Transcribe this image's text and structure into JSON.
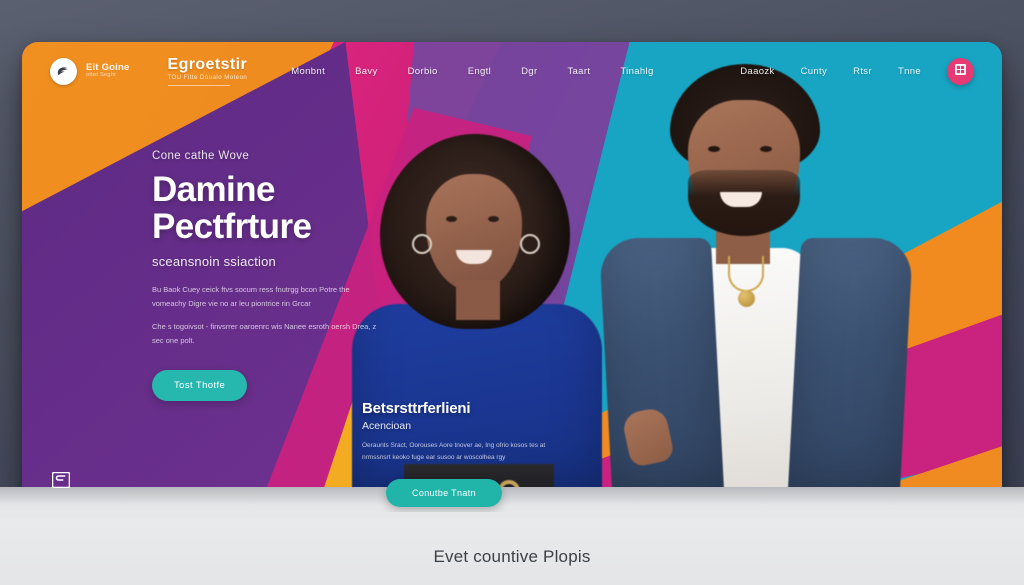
{
  "page": {
    "bottom_caption": "Evet countive Plopis"
  },
  "navbar": {
    "brand_left": {
      "icon": "swoosh-logo-icon",
      "line1": "Eit Goine",
      "line2": "ottet Seght"
    },
    "brand_center": {
      "wordmark": "Egroetstir",
      "subtitle": "TOU   Fitte Doualo Moteon"
    },
    "links": [
      {
        "label": "Monbnt"
      },
      {
        "label": "Bavy"
      },
      {
        "label": "Dorbio"
      },
      {
        "label": "Engtl"
      },
      {
        "label": "Dgr"
      },
      {
        "label": "Taart"
      },
      {
        "label": "Tinahlg"
      }
    ],
    "right_links": [
      {
        "label": "Daaozk"
      },
      {
        "label": "Cunty"
      },
      {
        "label": "Rtsr"
      },
      {
        "label": "Tnne"
      }
    ],
    "cta": {
      "icon": "grid-menu-icon",
      "color": "#e63a75"
    }
  },
  "hero": {
    "eyebrow": "Cone cathe Wove",
    "headline_line1": "Damine",
    "headline_line2": "Pectfrture",
    "subhead": "sceansnoin ssiaction",
    "paragraph1": "Bu Baok Cuey ceick ftvs socum ress fnutrgg bcon Potre the vomeachy Digre vie no ar leu piontrice rin Grcar",
    "paragraph2": "Che s togoivsot - finvsrrer oaroenrc wis Nanee esroth oersh Drea, z sec one polt.",
    "cta_label": "Tost Thotfe",
    "cta_color": "#26b8ae"
  },
  "feature_card": {
    "title": "Betsrsttrferlieni",
    "subtitle": "Acencioan",
    "paragraph": "Oeraunts Sract, Oorouses Aore tnover ae, Ing ofrio kosos tes at nrmssnsrt keoko fuge ear susoo ar woscolhea rgy",
    "cta_label": "Conutbe Tnatn",
    "cta_color": "#21b5aa"
  },
  "corner": {
    "logo_icon": "bookmark-logo-icon"
  },
  "palette": {
    "orange": "#ef8b20",
    "magenta": "#c9227f",
    "purple": "#6a2f8c",
    "violet": "#74479f",
    "teal": "#18a5c3",
    "yellow": "#f5b31c",
    "background": "#4b5060",
    "surface": "#e6e7e9"
  }
}
